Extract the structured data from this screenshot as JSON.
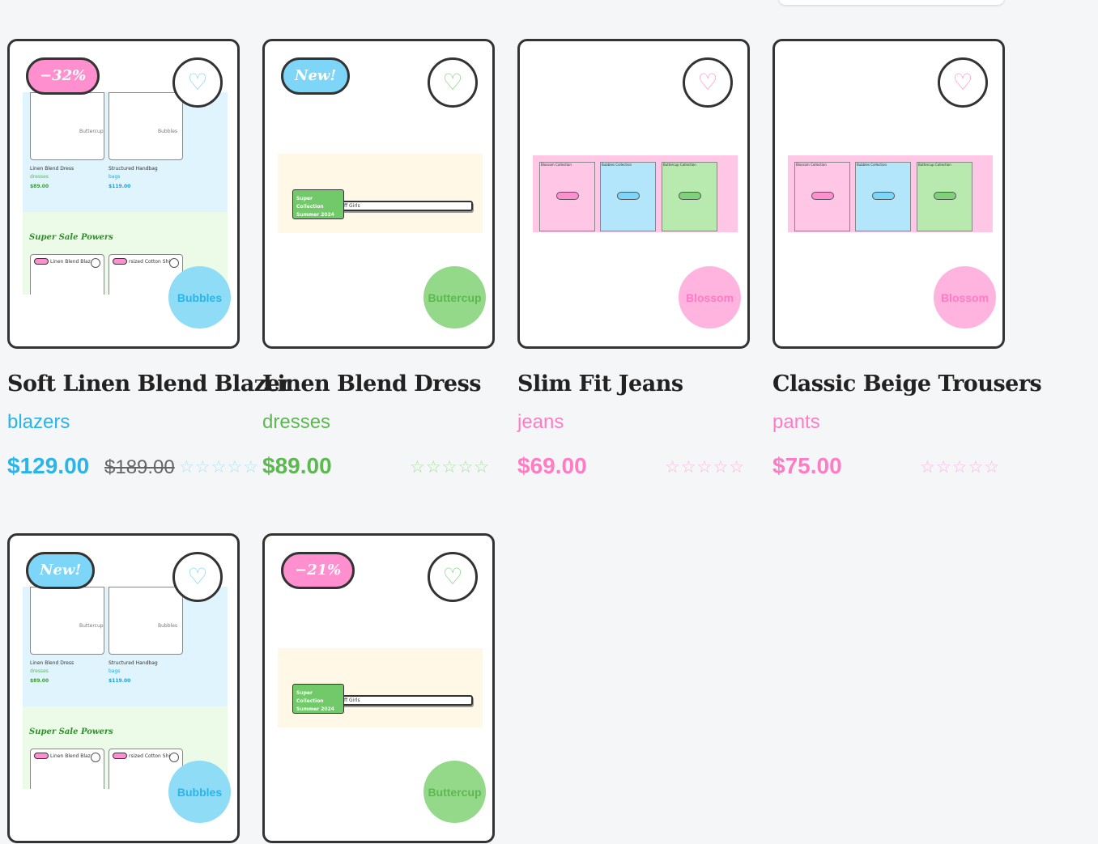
{
  "icons": {
    "favorite": "heart-outline-icon",
    "rating": "star-outline-icon"
  },
  "colors": {
    "bubbles": "#8fdcf7",
    "buttercup": "#94d98a",
    "blossom": "#ffb3df",
    "sale_badge": "#ff8fcf",
    "new_badge": "#7dd6f7"
  },
  "products": [
    {
      "title": "Soft Linen Blend Blazer",
      "category": "blazers",
      "price": "$129.00",
      "old_price": "$189.00",
      "badge": "−32%",
      "brand": "Bubbles",
      "rating": 0,
      "stars": "☆☆☆☆☆",
      "thumb": {
        "card1_title": "Linen Blend Dress",
        "card1_cat": "dresses",
        "card1_price": "$89.00",
        "card1_img": "Buttercup",
        "card2_title": "Structured Handbag",
        "card2_cat": "bags",
        "card2_price": "$119.00",
        "card2_img": "Bubbles",
        "section_title": "Super Sale Powers",
        "item1": "Linen Blend Blaz",
        "item2": "rsized Cotton Shir"
      }
    },
    {
      "title": "Linen Blend Dress",
      "category": "dresses",
      "price": "$89.00",
      "badge": "New!",
      "brand": "Buttercup",
      "rating": 0,
      "stars": "☆☆☆☆☆",
      "thumb": {
        "tag_line1": "Super Collection",
        "tag_line2": "Summer 2024",
        "bar_text": "ff Girls"
      }
    },
    {
      "title": "Slim Fit Jeans",
      "category": "jeans",
      "price": "$69.00",
      "brand": "Blossom",
      "rating": 0,
      "stars": "☆☆☆☆☆",
      "thumb": {
        "panel1": "Blossom Collection",
        "panel2": "Bubbles Collection",
        "panel3": "Buttercup Collection"
      }
    },
    {
      "title": "Classic Beige Trousers",
      "category": "pants",
      "price": "$75.00",
      "brand": "Blossom",
      "rating": 0,
      "stars": "☆☆☆☆☆",
      "thumb": {
        "panel1": "Blossom Collection",
        "panel2": "Bubbles Collection",
        "panel3": "Buttercup Collection"
      }
    },
    {
      "badge": "New!",
      "brand": "Bubbles",
      "thumb": {
        "card1_title": "Linen Blend Dress",
        "card1_cat": "dresses",
        "card1_price": "$89.00",
        "card1_img": "Buttercup",
        "card2_title": "Structured Handbag",
        "card2_cat": "bags",
        "card2_price": "$119.00",
        "card2_img": "Bubbles",
        "section_title": "Super Sale Powers",
        "item1": "Linen Blend Blaz",
        "item2": "rsized Cotton Shir"
      }
    },
    {
      "badge": "−21%",
      "brand": "Buttercup",
      "thumb": {
        "tag_line1": "Super Collection",
        "tag_line2": "Summer 2024",
        "bar_text": "ff Girls"
      }
    }
  ]
}
